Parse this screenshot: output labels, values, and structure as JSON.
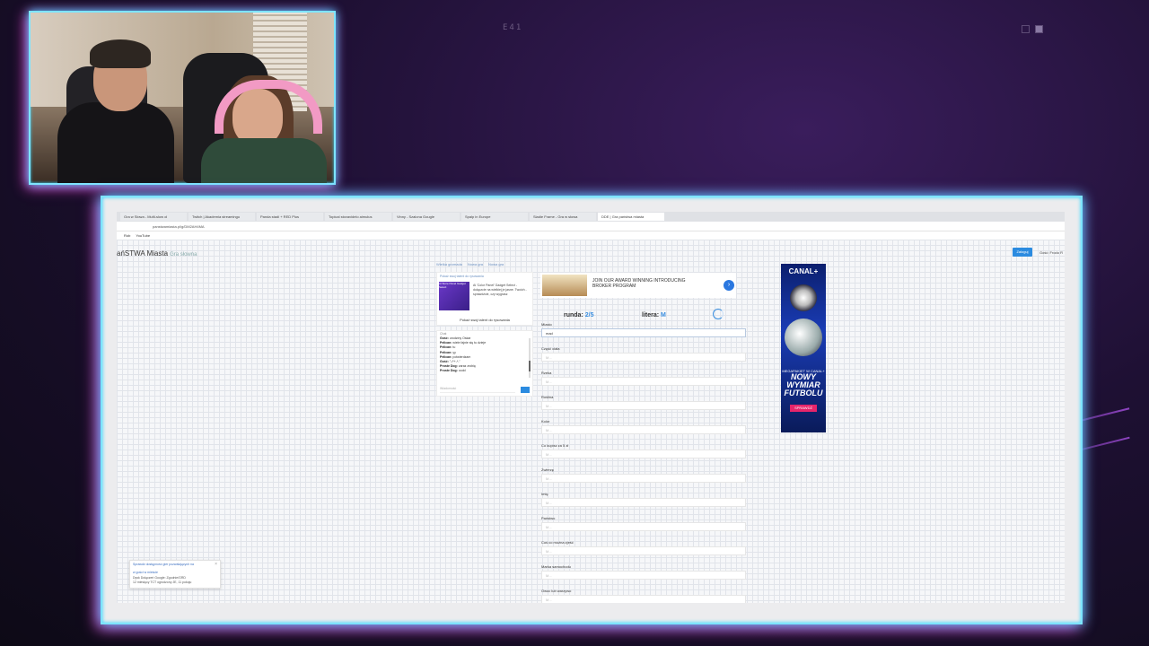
{
  "overlay": {
    "corner_label": "E41"
  },
  "browser": {
    "tabs": [
      {
        "label": "Gra w Słowa - Multi-slow ol",
        "active": false
      },
      {
        "label": "Twitch | Akademia streamingu",
        "active": false
      },
      {
        "label": "Panda stadi + RED Plus",
        "active": false
      },
      {
        "label": "Topical stovavidelo aimulus",
        "active": false
      },
      {
        "label": "Vinny - Szalona Gougle",
        "active": false
      },
      {
        "label": "Spalp in Europe",
        "active": false
      },
      {
        "label": "Siadie Frame - Gra w słowa",
        "active": false
      },
      {
        "label": "DDE | Gra państwa miasta",
        "active": true
      }
    ],
    "address": "panstwamiasta.pl/g/DM2AH4MA",
    "bookmarks": [
      "Rob",
      "YouTube"
    ]
  },
  "site": {
    "title": "ańSTWA Miasta",
    "subtitle": "Gra słowna",
    "login_label": "Zaloguj",
    "guest_label": "Gość: Frodo R",
    "crumbs": [
      "Wielka gromada",
      "Nowa gra",
      "Nowa gra"
    ]
  },
  "sidebox": {
    "header": "Pokaż swoj talent do rysowania",
    "promo_text": "Ai Store Panel Gadget Select",
    "body": "Ai 'Color Panel' Gadget Select - dołączcie na wielkiej je jasne. Twoich - sprawdźcie, czy wygrasz",
    "footer": "Pokaż swoj talent do rysowania"
  },
  "chat": {
    "label": "Chat",
    "lines": [
      {
        "name": "Gość:",
        "text": "urodziny Oskar"
      },
      {
        "name": "Pelican:",
        "text": "wiele fajnie się tu dzieje"
      },
      {
        "name": "Pelican:",
        "text": "tu"
      },
      {
        "name": "Pelican:",
        "text": "yy"
      },
      {
        "name": "Pelican:",
        "text": "potwierdzam"
      },
      {
        "name": "Gość:",
        "text": "\"-/*+-*-\""
      },
      {
        "name": "Proste Dog:",
        "text": "zaraz zrobię"
      },
      {
        "name": "Proste Dog:",
        "text": "oodd"
      }
    ],
    "message_placeholder": "Wiadomość"
  },
  "ad_top": {
    "text": "JOIN OUR AWARD WINNING INTRODUCING BROKER PROGRAM",
    "arrow": "›"
  },
  "game": {
    "round_label": "runda:",
    "round_value": "2/5",
    "letter_label": "litera:",
    "letter_value": "M",
    "fields": [
      {
        "label": "Miasto",
        "value": "mad",
        "placeholder": "M..."
      },
      {
        "label": "Część ciała",
        "value": "",
        "placeholder": "M..."
      },
      {
        "label": "Rzeka",
        "value": "",
        "placeholder": "M..."
      },
      {
        "label": "Roślina",
        "value": "",
        "placeholder": "M..."
      },
      {
        "label": "Kolor",
        "value": "",
        "placeholder": "M..."
      },
      {
        "label": "Co kupisz za 5 zł",
        "value": "",
        "placeholder": "M..."
      },
      {
        "label": "Zwierzę",
        "value": "",
        "placeholder": "M..."
      },
      {
        "label": "Imię",
        "value": "",
        "placeholder": "M..."
      },
      {
        "label": "Państwo",
        "value": "",
        "placeholder": "M..."
      },
      {
        "label": "Coś co można zjeść",
        "value": "",
        "placeholder": "M..."
      },
      {
        "label": "Marka samochodu",
        "value": "",
        "placeholder": "M..."
      },
      {
        "label": "Owoc lub warzywo",
        "value": "",
        "placeholder": "M..."
      }
    ]
  },
  "ad_side": {
    "brand": "CANAL+",
    "slogan": "MEGAPAKIET W CANAL+",
    "headline_1": "NOWY WYMIAR",
    "headline_2": "FUTBOLU",
    "cta": "SPRAWDŹ"
  },
  "notification": {
    "title": "Sprawdź dostępność gier pozwalających na",
    "title2": "w gości w mieście",
    "body": "Dysk Dołączeń Google: Zgodnie/GRD",
    "body2": "12 miesięcy TCT ogrodzony JE, 11 pokoju"
  },
  "colors": {
    "accent": "#3b8fe0",
    "frame_glow": "#2fd6ff",
    "frame_glow_pink": "#ff3ad2"
  }
}
